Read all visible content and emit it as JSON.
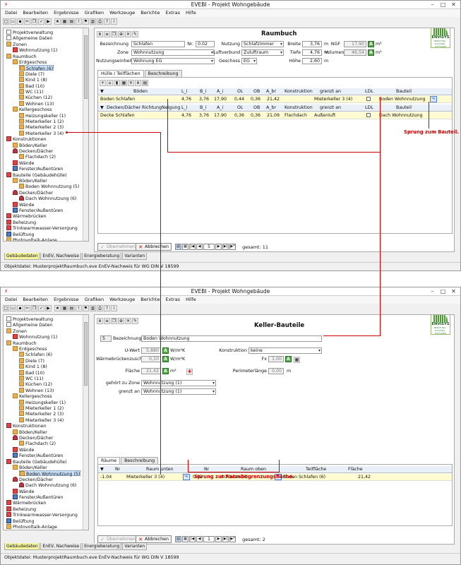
{
  "app": {
    "title": "EVEBI - Projekt Wohngebäude",
    "menu": [
      "Datei",
      "Bearbeiten",
      "Ergebnisse",
      "Grafiken",
      "Werkzeuge",
      "Berichte",
      "Extras",
      "Hilfe"
    ]
  },
  "tree": [
    {
      "label": "Projektverwaltung",
      "icon": "page"
    },
    {
      "label": "Allgemeine Daten",
      "icon": "page"
    },
    {
      "label": "Zonen",
      "icon": "folder"
    },
    {
      "label": "Wohnnutzung (1)",
      "icon": "red"
    },
    {
      "label": "Raumbuch",
      "icon": "folder"
    },
    {
      "label": "Erdgeschoss",
      "icon": "folder"
    },
    {
      "label": "Schlafen (6)",
      "icon": "folder"
    },
    {
      "label": "Diele (7)",
      "icon": "folder"
    },
    {
      "label": "Kind 1 (8)",
      "icon": "folder"
    },
    {
      "label": "Bad (10)",
      "icon": "folder"
    },
    {
      "label": "WC (11)",
      "icon": "folder"
    },
    {
      "label": "Küchen (12)",
      "icon": "folder"
    },
    {
      "label": "Wohnen (13)",
      "icon": "folder"
    },
    {
      "label": "Kellergeschoss",
      "icon": "folder"
    },
    {
      "label": "Heizungskeller (1)",
      "icon": "folder"
    },
    {
      "label": "Mieterkeller 1 (2)",
      "icon": "folder"
    },
    {
      "label": "Mieterkeller 2 (3)",
      "icon": "folder"
    },
    {
      "label": "Mieterkeller 3 (4)",
      "icon": "folder"
    },
    {
      "label": "Konstruktionen",
      "icon": "red"
    },
    {
      "label": "Böden/Keller",
      "icon": "folder"
    },
    {
      "label": "Decken/Dächer",
      "icon": "roof"
    },
    {
      "label": "Flachdach (2)",
      "icon": "folder"
    },
    {
      "label": "Wände",
      "icon": "red"
    },
    {
      "label": "Fenster/Außentüren",
      "icon": "blue"
    },
    {
      "label": "Bauteile (Gebäudehülle)",
      "icon": "red"
    },
    {
      "label": "Böden/Keller",
      "icon": "folder"
    },
    {
      "label": "Boden Wohnnutzung (5)",
      "icon": "folder"
    },
    {
      "label": "Decken/Dächer",
      "icon": "roof"
    },
    {
      "label": "Dach Wohnnutzung (6)",
      "icon": "roof"
    },
    {
      "label": "Wände",
      "icon": "red"
    },
    {
      "label": "Fenster/Außentüren",
      "icon": "blue"
    },
    {
      "label": "Wärmebrücken",
      "icon": "red"
    },
    {
      "label": "Beheizung",
      "icon": "red"
    },
    {
      "label": "Trinkwarmwasser-Versorgung",
      "icon": "red"
    },
    {
      "label": "Belüftung",
      "icon": "blue"
    },
    {
      "label": "Photovoltaik-Anlage",
      "icon": "folder"
    },
    {
      "label": "Wärmeerzeugung",
      "icon": "folder"
    }
  ],
  "top": {
    "title": "Raumbuch",
    "logo": {
      "name": "ENVISYS",
      "sub": "BERATUNG · PLANUNG · SOFTWARE"
    },
    "fields": {
      "bezeichnung_label": "Bezeichnung",
      "bezeichnung": "Schlafen",
      "nr_label": "Nr.",
      "nr": "0.02",
      "nutzung_label": "Nutzung",
      "nutzung": "Schlafzimmer",
      "breite_label": "Breite",
      "breite": "3,76",
      "breite_unit": "m",
      "ngf_label": "NGF",
      "ngf": "17,90",
      "ngf_unit": "m²",
      "zone_label": "Zone",
      "zone": "Wohnnutzung",
      "luftverbund_label": "Luftverbund",
      "luftverbund": "Zuluftraum",
      "tiefe_label": "Tiefe",
      "tiefe": "4,76",
      "tiefe_unit": "m",
      "volumen_label": "Volumen",
      "volumen": "46,54",
      "volumen_unit": "m³",
      "nutzungseinheit_label": "Nutzungseinheit",
      "nutzungseinheit": "Wohnung EG",
      "geschoss_label": "Geschoss",
      "geschoss": "EG",
      "hoehe_label": "Höhe",
      "hoehe": "2,60",
      "hoehe_unit": "m"
    },
    "tabs": [
      "Hülle / Teilflächen",
      "Beschreibung"
    ],
    "grid1": {
      "headers": [
        "Böden",
        "L_i",
        "B_i",
        "A_i",
        "OL",
        "OB",
        "A_br",
        "Konstruktion",
        "grenzt an",
        "LDL",
        "Bauteil"
      ],
      "row": [
        "Boden Schlafen",
        "4,76",
        "3,76",
        "17,90",
        "0,44",
        "0,36",
        "21,42",
        "",
        "Mieterkeller 3 (4)",
        "",
        "Boden Wohnnutzung"
      ]
    },
    "grid2": {
      "headers": [
        "Decken/Dächer",
        "Richtung",
        "Neigung",
        "L_i",
        "B_i",
        "A_i",
        "OL",
        "OB",
        "A_br",
        "Konstruktion",
        "grenzt an",
        "LDL",
        "Bauteil"
      ],
      "row": [
        "Decke Schlafen",
        "",
        "",
        "4,76",
        "3,76",
        "17,90",
        "0,36",
        "0,36",
        "21,09",
        "Flachdach",
        "Außenluft",
        "",
        "Dach Wohnnutzung"
      ]
    },
    "buttons": {
      "apply": "Übernehmen",
      "cancel": "Abbrechen"
    },
    "nav": {
      "page": "5",
      "total": "gesamt: 11"
    },
    "bottom_tabs": [
      "Gebäudedaten",
      "EnEV, Nachweise",
      "Energieberatung",
      "Varianten"
    ],
    "status": "Objektdatei: MusterprojektRaumbuch.eve  EnEV-Nachweis für WG DIN V 18599",
    "annotation": "Sprung zum Bauteil."
  },
  "bottom": {
    "title": "Keller-Bauteile",
    "fields": {
      "id": "5",
      "bezeichnung_label": "Bezeichnung",
      "bezeichnung": "Boden Wohnnutzung",
      "uwert_label": "U-Wert",
      "uwert": "5,880",
      "uwert_unit": "W/m²K",
      "konstruktion_label": "Konstruktion",
      "konstruktion": "keine",
      "wbz_label": "Wärmebrückenzuschlag",
      "wbz": "0,10",
      "wbz_unit": "W/m²K",
      "fx_label": "Fx",
      "fx": "1,00",
      "flaeche_label": "Fläche",
      "flaeche": "21,42",
      "flaeche_unit": "m²",
      "perimeter_label": "Perimeterlänge",
      "perimeter": "0,00",
      "perimeter_unit": "m",
      "zone_label": "gehört zu Zone",
      "zone": "Wohnnutzung (1)",
      "grenzt_label": "grenzt an",
      "grenzt": "Wohnnutzung (1)"
    },
    "tabs": [
      "Räume",
      "Beschreibung"
    ],
    "grid": {
      "headers": [
        "Nr",
        "Raum unten",
        "Nr",
        "Raum oben",
        "Teilfläche",
        "Fläche"
      ],
      "row": [
        "-1.04",
        "Mieterkeller 3 (4)",
        "0.02",
        "Schlafen (6)",
        "Boden Schlafen (6)",
        "21,42"
      ]
    },
    "buttons": {
      "apply": "Übernehmen",
      "cancel": "Abbrechen"
    },
    "nav": {
      "page": "1",
      "total": "gesamt: 2"
    },
    "bottom_tabs": [
      "Gebäudedaten",
      "EnEV, Nachweise",
      "Energieberatung",
      "Varianten"
    ],
    "status": "Objektdatei: MusterprojektRaumbuch.eve  EnEV-Nachweis für WG DIN V 18599",
    "annotation": "Sprung zur Raumbegrenzungsfläche."
  },
  "colors": {
    "accent": "#cc0000",
    "selection": "#cde3fb",
    "rowHighlight": "#fffbd0",
    "aButton": "#55aa44"
  }
}
